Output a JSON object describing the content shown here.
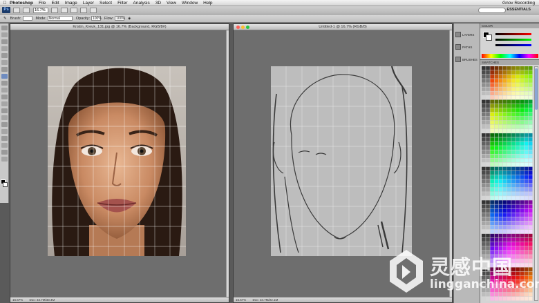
{
  "menubar": {
    "app_name": "Photoshop",
    "items": [
      "File",
      "Edit",
      "Image",
      "Layer",
      "Select",
      "Filter",
      "Analysis",
      "3D",
      "View",
      "Window",
      "Help"
    ],
    "right_status": "Gnov Recording"
  },
  "appbar": {
    "zoom": "16.7%",
    "workspace": "ESSENTIALS"
  },
  "options_bar": {
    "brush_label": "Brush:",
    "mode_label": "Mode:",
    "mode_value": "Normal",
    "opacity_label": "Opacity:",
    "opacity_value": "100%",
    "flow_label": "Flow:",
    "flow_value": "100%"
  },
  "documents": {
    "left": {
      "title": "Kristin_Kreuk_131.jpg @ 16.7% (Background, RGB/8#)",
      "zoom": "16.67%",
      "doc_size": "Doc: 34.7M/33.4M"
    },
    "right": {
      "title": "Untitled-1 @ 16.7% (RGB/8)",
      "zoom": "16.67%",
      "doc_size": "Doc: 34.7M/22.1M"
    }
  },
  "panels": {
    "dock": {
      "layers": "LAYERS",
      "paths": "PATHS",
      "brushes": "BRUSHES"
    },
    "color_title": "COLOR",
    "swatches_title": "SWATCHES"
  },
  "colors": {
    "fg": "#000000",
    "bg": "#ffffff"
  },
  "watermark": {
    "brand": "灵感中国",
    "url": "lingganchina.com"
  }
}
